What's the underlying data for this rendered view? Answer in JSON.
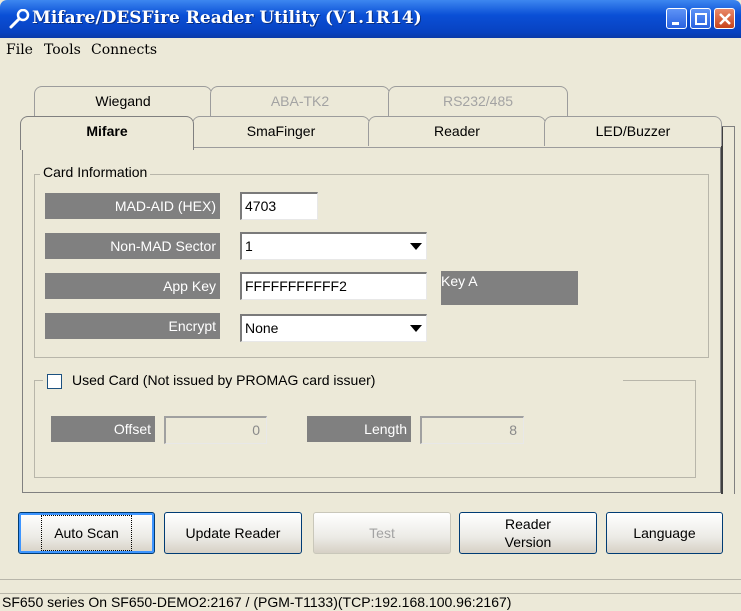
{
  "window": {
    "title": "Mifare/DESFire Reader Utility (V1.1R14)"
  },
  "menu": [
    "File",
    "Tools",
    "Connects"
  ],
  "tabs_back": [
    {
      "label": "Wiegand",
      "enabled": true
    },
    {
      "label": "ABA-TK2",
      "enabled": false
    },
    {
      "label": "RS232/485",
      "enabled": false
    }
  ],
  "tabs_front": [
    {
      "label": "Mifare",
      "active": true
    },
    {
      "label": "SmaFinger"
    },
    {
      "label": "Reader"
    },
    {
      "label": "LED/Buzzer"
    }
  ],
  "card_info": {
    "legend": "Card Information",
    "mad_aid_label": "MAD-AID (HEX)",
    "mad_aid_value": "4703",
    "non_mad_label": "Non-MAD Sector",
    "non_mad_value": "1",
    "app_key_label": "App Key",
    "app_key_value": "FFFFFFFFFFF2",
    "key_type": "Key A",
    "encrypt_label": "Encrypt",
    "encrypt_value": "None"
  },
  "used_card": {
    "label": "Used Card (Not issued by PROMAG card issuer)",
    "checked": false,
    "offset_label": "Offset",
    "offset_value": "0",
    "length_label": "Length",
    "length_value": "8"
  },
  "buttons": {
    "auto_scan": "Auto Scan",
    "update_reader": "Update Reader",
    "test": "Test",
    "reader_version_1": "Reader",
    "reader_version_2": "Version",
    "language": "Language"
  },
  "status": "SF650 series On SF650-DEMO2:2167 / (PGM-T1133)(TCP:192.168.100.96:2167)"
}
